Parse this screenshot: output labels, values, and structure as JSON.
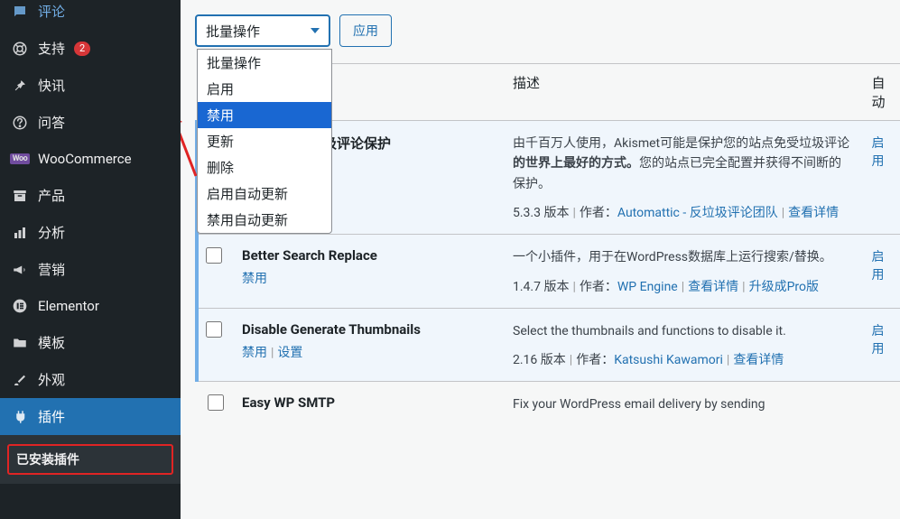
{
  "sidebar": {
    "items": [
      {
        "label": "评论",
        "icon": "💬"
      },
      {
        "label": "支持",
        "icon": "life-ring",
        "badge": "2"
      },
      {
        "label": "快讯",
        "icon": "📌"
      },
      {
        "label": "问答",
        "icon": "?"
      },
      {
        "label": "WooCommerce",
        "icon": "woo"
      },
      {
        "label": "产品",
        "icon": "archive"
      },
      {
        "label": "分析",
        "icon": "chart"
      },
      {
        "label": "营销",
        "icon": "megaphone"
      },
      {
        "label": "Elementor",
        "icon": "E"
      },
      {
        "label": "模板",
        "icon": "folder"
      },
      {
        "label": "外观",
        "icon": "brush"
      },
      {
        "label": "插件",
        "icon": "plug"
      }
    ],
    "submenu": {
      "installed": "已安装插件"
    }
  },
  "topbar": {
    "bulk_label": "批量操作",
    "apply_label": "应用",
    "dropdown": [
      "批量操作",
      "启用",
      "禁用",
      "更新",
      "删除",
      "启用自动更新",
      "禁用自动更新"
    ],
    "selected_index": 2
  },
  "table": {
    "th_desc": "描述",
    "th_auto": "自动",
    "rows": [
      {
        "name_suffix": "垃圾评论：垃圾评论保护",
        "name_full": "Akismet 反垃圾评论：垃圾评论保护",
        "active": true,
        "actions": [],
        "desc_prefix": "由千百万人使用，Akismet可能是保护您的站点免受垃圾评论",
        "desc_bold": "的世界上最好的方式。",
        "desc_suffix": "您的站点已完全配置并获得不间断的保护。",
        "version": "5.3.3 版本",
        "author_label": "作者：",
        "author": "Automattic - 反垃圾评论团队",
        "meta_extra": "查看详情",
        "auto_label": "启用"
      },
      {
        "name": "Better Search Replace",
        "active": true,
        "action1": "禁用",
        "desc": "一个小插件，用于在WordPress数据库上运行搜索/替换。",
        "version": "1.4.7 版本",
        "author_label": "作者：",
        "author": "WP Engine",
        "link_details": "查看详情",
        "link_upgrade": "升级成Pro版",
        "auto_label": "启用"
      },
      {
        "name": "Disable Generate Thumbnails",
        "active": true,
        "action1": "禁用",
        "action2": "设置",
        "desc": "Select the thumbnails and functions to disable it.",
        "version": "2.16 版本",
        "author_label": "作者：",
        "author": "Katsushi Kawamori",
        "link_details": "查看详情",
        "auto_label": "启用"
      },
      {
        "name": "Easy WP SMTP",
        "active": false,
        "desc": "Fix your WordPress email delivery by sending"
      }
    ]
  }
}
